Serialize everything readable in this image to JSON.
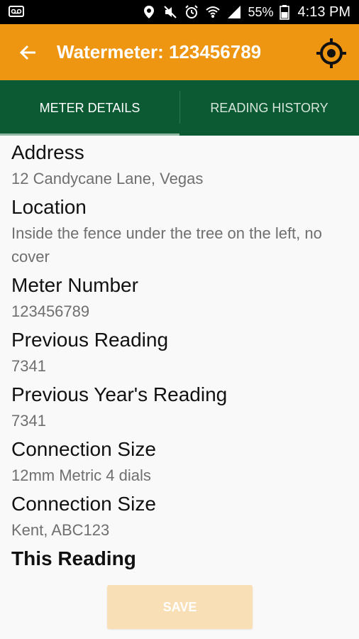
{
  "status_bar": {
    "battery_percent": "55%",
    "time": "4:13 PM",
    "icons": [
      "voicemail-icon",
      "location-icon",
      "mute-icon",
      "alarm-icon",
      "wifi-icon",
      "signal-icon",
      "battery-icon"
    ]
  },
  "app_bar": {
    "title": "Watermeter: 123456789",
    "back_icon": "arrow-left-icon",
    "action_icon": "crosshair-icon",
    "color": "#ee9612"
  },
  "tabs": [
    {
      "label": "METER DETAILS",
      "active": true
    },
    {
      "label": "READING HISTORY",
      "active": false
    }
  ],
  "tabs_color": "#0b5a33",
  "fields": [
    {
      "label": "Address",
      "value": "12 Candycane Lane, Vegas"
    },
    {
      "label": "Location",
      "value": "Inside the fence under the tree on the left, no cover"
    },
    {
      "label": "Meter Number",
      "value": "123456789"
    },
    {
      "label": "Previous Reading",
      "value": "7341"
    },
    {
      "label": "Previous Year's Reading",
      "value": "7341"
    },
    {
      "label": "Connection Size",
      "value": "12mm Metric 4 dials"
    },
    {
      "label": "Connection Size",
      "value": "Kent, ABC123"
    },
    {
      "label": "This Reading",
      "value": ""
    }
  ],
  "save_button": {
    "label": "SAVE",
    "enabled": false
  }
}
